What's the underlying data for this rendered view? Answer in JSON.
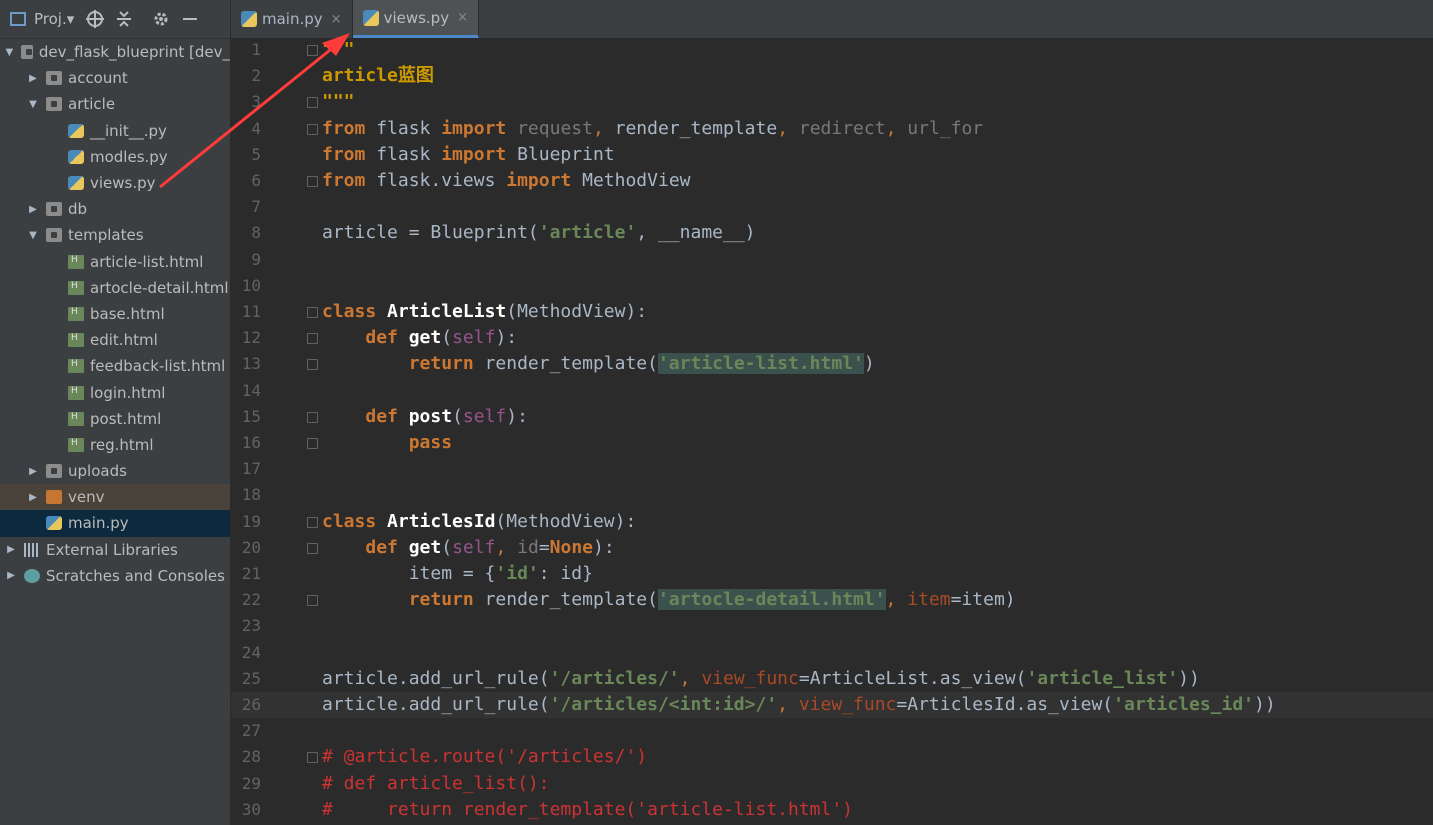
{
  "sidebar": {
    "toolbar_label": "Proj.▾",
    "items": [
      {
        "label": "dev_flask_blueprint [dev_",
        "indent": 0,
        "arrow": "▼",
        "icon": "folder"
      },
      {
        "label": "account",
        "indent": 1,
        "arrow": "▶",
        "icon": "folder"
      },
      {
        "label": "article",
        "indent": 1,
        "arrow": "▼",
        "icon": "folder"
      },
      {
        "label": "__init__.py",
        "indent": 2,
        "arrow": "",
        "icon": "py"
      },
      {
        "label": "modles.py",
        "indent": 2,
        "arrow": "",
        "icon": "py"
      },
      {
        "label": "views.py",
        "indent": 2,
        "arrow": "",
        "icon": "py"
      },
      {
        "label": "db",
        "indent": 1,
        "arrow": "▶",
        "icon": "folder"
      },
      {
        "label": "templates",
        "indent": 1,
        "arrow": "▼",
        "icon": "folder"
      },
      {
        "label": "article-list.html",
        "indent": 2,
        "arrow": "",
        "icon": "html"
      },
      {
        "label": "artocle-detail.html",
        "indent": 2,
        "arrow": "",
        "icon": "html"
      },
      {
        "label": "base.html",
        "indent": 2,
        "arrow": "",
        "icon": "html"
      },
      {
        "label": "edit.html",
        "indent": 2,
        "arrow": "",
        "icon": "html"
      },
      {
        "label": "feedback-list.html",
        "indent": 2,
        "arrow": "",
        "icon": "html"
      },
      {
        "label": "login.html",
        "indent": 2,
        "arrow": "",
        "icon": "html"
      },
      {
        "label": "post.html",
        "indent": 2,
        "arrow": "",
        "icon": "html"
      },
      {
        "label": "reg.html",
        "indent": 2,
        "arrow": "",
        "icon": "html"
      },
      {
        "label": "uploads",
        "indent": 1,
        "arrow": "▶",
        "icon": "folder"
      },
      {
        "label": "venv",
        "indent": 1,
        "arrow": "▶",
        "icon": "folder-orange"
      },
      {
        "label": "main.py",
        "indent": 1,
        "arrow": "",
        "icon": "py"
      },
      {
        "label": "External Libraries",
        "indent": 0,
        "arrow": "▶",
        "icon": "lib"
      },
      {
        "label": "Scratches and Consoles",
        "indent": 0,
        "arrow": "▶",
        "icon": "scratch"
      }
    ]
  },
  "tabs": [
    {
      "label": "main.py",
      "active": false
    },
    {
      "label": "views.py",
      "active": true
    }
  ],
  "close_glyph": "×",
  "editor": {
    "line_numbers": [
      "1",
      "2",
      "3",
      "4",
      "5",
      "6",
      "7",
      "8",
      "9",
      "10",
      "11",
      "12",
      "13",
      "14",
      "15",
      "16",
      "17",
      "18",
      "19",
      "20",
      "21",
      "22",
      "23",
      "24",
      "25",
      "26",
      "27",
      "28",
      "29",
      "30"
    ],
    "doc_quote": "\"\"\"",
    "doc_text": "article蓝图",
    "line8_var": "article",
    "line8_rest": " = Blueprint(",
    "line8_str": "'article'",
    "line8_tail": ", __name__)",
    "class1": "ArticleList",
    "class2": "ArticlesId",
    "str_article_list_html": "'article-list.html'",
    "str_artocle_detail_html": "'artocle-detail.html'",
    "str_url1": "'/articles/'",
    "str_url2": "'/articles/<int:id>/'",
    "str_view1": "'article_list'",
    "str_view2": "'articles_id'",
    "comment1": "# @article.route('/articles/')",
    "comment2": "# def article_list():",
    "comment3": "#     return render_template('article-list.html')"
  }
}
